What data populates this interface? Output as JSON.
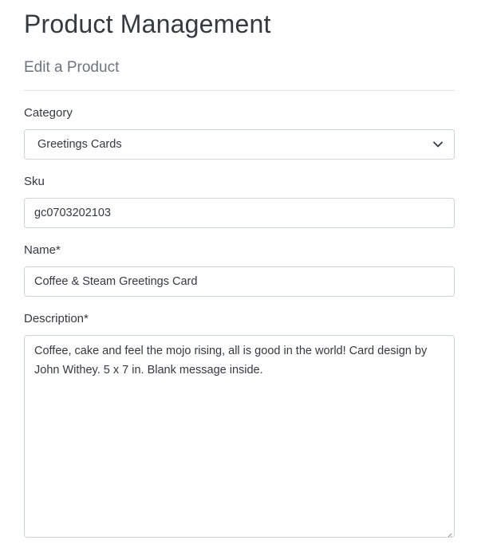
{
  "header": {
    "title": "Product Management",
    "subtitle": "Edit a Product"
  },
  "form": {
    "category": {
      "label": "Category",
      "value": "Greetings Cards",
      "icon": "chevron-down-icon"
    },
    "sku": {
      "label": "Sku",
      "value": "gc0703202103"
    },
    "name": {
      "label": "Name*",
      "value": "Coffee & Steam Greetings Card"
    },
    "description": {
      "label": "Description*",
      "value": "Coffee, cake and feel the mojo rising, all is good in the world! Card design by John Withey. 5 x 7 in. Blank message inside."
    }
  }
}
